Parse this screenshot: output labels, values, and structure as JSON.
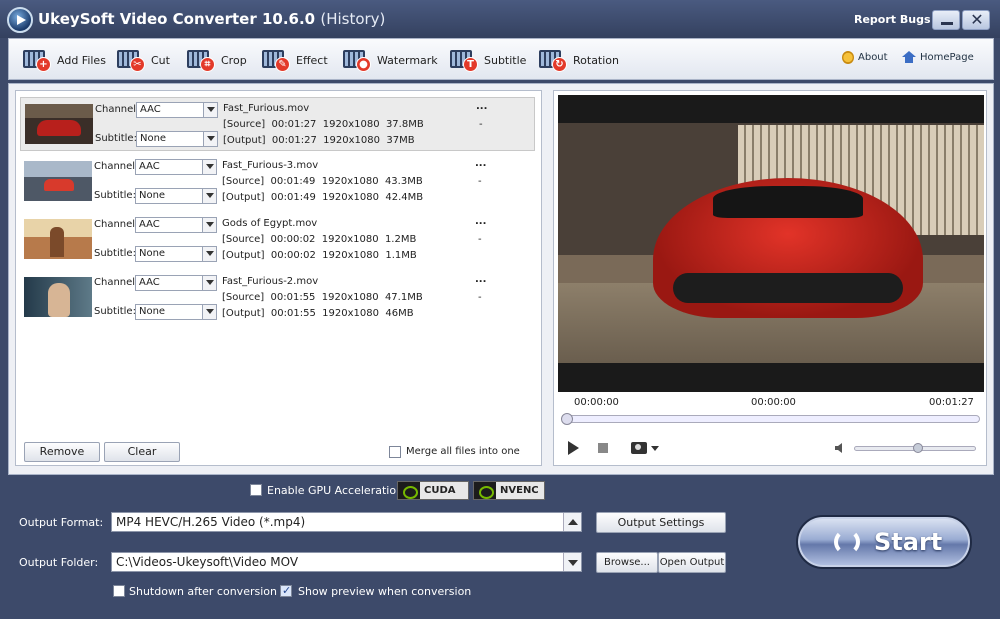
{
  "window": {
    "title": "UkeySoft Video Converter 10.6.0",
    "subtitle": "(History)",
    "report_bugs": "Report Bugs"
  },
  "toolbar": {
    "items": [
      {
        "label": "Add Files",
        "icon": "add-files-icon"
      },
      {
        "label": "Cut",
        "icon": "cut-icon"
      },
      {
        "label": "Crop",
        "icon": "crop-icon"
      },
      {
        "label": "Effect",
        "icon": "effect-icon"
      },
      {
        "label": "Watermark",
        "icon": "watermark-icon"
      },
      {
        "label": "Subtitle",
        "icon": "subtitle-icon"
      },
      {
        "label": "Rotation",
        "icon": "rotation-icon"
      }
    ],
    "about": "About",
    "homepage": "HomePage"
  },
  "file_labels": {
    "channel": "Channel:",
    "subtitle": "Subtitle:"
  },
  "files": [
    {
      "name": "Fast_Furious.mov",
      "channel": "AAC",
      "subtitle": "None",
      "source": "[Source]  00:01:27  1920x1080  37.8MB",
      "output": "[Output]  00:01:27  1920x1080  37MB",
      "dots": "...",
      "dash": "-"
    },
    {
      "name": "Fast_Furious-3.mov",
      "channel": "AAC",
      "subtitle": "None",
      "source": "[Source]  00:01:49  1920x1080  43.3MB",
      "output": "[Output]  00:01:49  1920x1080  42.4MB",
      "dots": "...",
      "dash": "-"
    },
    {
      "name": "Gods of Egypt.mov",
      "channel": "AAC",
      "subtitle": "None",
      "source": "[Source]  00:00:02  1920x1080  1.2MB",
      "output": "[Output]  00:00:02  1920x1080  1.1MB",
      "dots": "...",
      "dash": "-"
    },
    {
      "name": "Fast_Furious-2.mov",
      "channel": "AAC",
      "subtitle": "None",
      "source": "[Source]  00:01:55  1920x1080  47.1MB",
      "output": "[Output]  00:01:55  1920x1080  46MB",
      "dots": "...",
      "dash": "-"
    }
  ],
  "list_footer": {
    "remove": "Remove",
    "clear": "Clear",
    "merge": "Merge all files into one"
  },
  "preview": {
    "time_current": "00:00:00",
    "time_middle": "00:00:00",
    "time_total": "00:01:27"
  },
  "gpu": {
    "label": "Enable GPU Acceleration",
    "cuda": "CUDA",
    "nvenc": "NVENC"
  },
  "output": {
    "format_label": "Output Format:",
    "format_value": "MP4 HEVC/H.265 Video (*.mp4)",
    "settings_button": "Output Settings",
    "folder_label": "Output Folder:",
    "folder_value": "C:\\Videos-Ukeysoft\\Video MOV",
    "browse_button": "Browse...",
    "open_output_button": "Open Output"
  },
  "options": {
    "shutdown": "Shutdown after conversion",
    "show_preview": "Show preview when conversion"
  },
  "start": {
    "label": "Start"
  }
}
